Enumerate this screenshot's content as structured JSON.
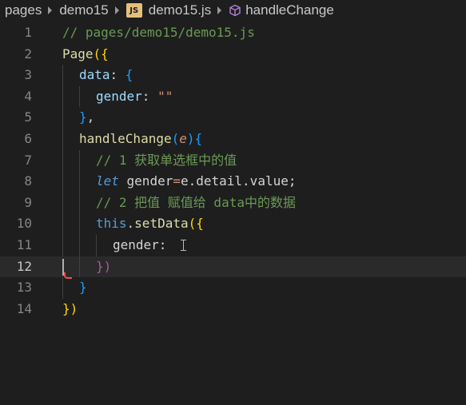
{
  "breadcrumb": {
    "items": [
      "pages",
      "demo15",
      "demo15.js",
      "handleChange"
    ],
    "js_icon_text": "JS",
    "method_icon": "cube-method-icon"
  },
  "editor": {
    "current_line": 12,
    "line_numbers": [
      "1",
      "2",
      "3",
      "4",
      "5",
      "6",
      "7",
      "8",
      "9",
      "10",
      "11",
      "12",
      "13",
      "14"
    ],
    "lines": [
      {
        "t1": "// pages/demo15/demo15.js"
      },
      {
        "t1": "Page",
        "t2": "({"
      },
      {
        "t1": "data",
        "t2": ": ",
        "t3": "{"
      },
      {
        "t1": "gender",
        "t2": ": ",
        "t3": "\"\""
      },
      {
        "t1": "}",
        "t2": ","
      },
      {
        "t1": "handleChange",
        "t2": "(",
        "t3": "e",
        "t4": ")",
        "t5": "{"
      },
      {
        "t1": "// 1 获取单选框中的值"
      },
      {
        "t1": "let",
        "t2": " gender",
        "t3": "=",
        "t4": "e.detail.value",
        "t5": ";"
      },
      {
        "t1": "// 2 把值 赋值给 data中的数据"
      },
      {
        "t1": "this",
        "t2": ".",
        "t3": "setData",
        "t4": "({"
      },
      {
        "t1": "gender",
        "t2": ": "
      },
      {
        "t1": "})"
      },
      {
        "t1": "}"
      },
      {
        "t1": "})"
      }
    ]
  },
  "colors": {
    "background": "#1e1e1e",
    "comment": "#6a9955",
    "function": "#dcdcaa",
    "keyword": "#569cd6",
    "property": "#9cdcfe",
    "string": "#ce9178",
    "bracket_gold": "#ffd700",
    "bracket_orchid": "#da70d6",
    "bracket_blue": "#179fff"
  }
}
